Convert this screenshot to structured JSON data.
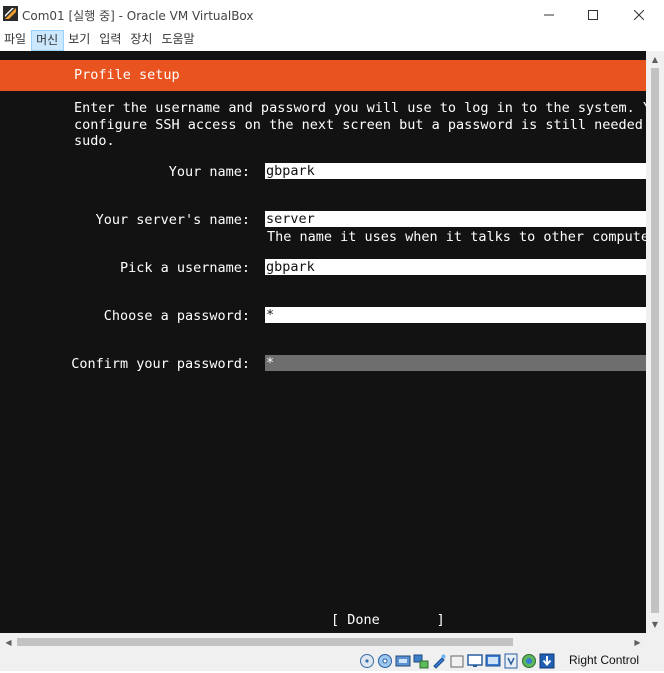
{
  "window": {
    "title": "Com01 [실행 중] - Oracle VM VirtualBox",
    "controls": [
      "minimize",
      "maximize",
      "close"
    ]
  },
  "menu": {
    "items": [
      "파일",
      "머신",
      "보기",
      "입력",
      "장치",
      "도움말"
    ],
    "active": "머신"
  },
  "installer": {
    "header_title": "Profile setup",
    "intro_lines": [
      "Enter the username and password you will use to log in to the system. Yo",
      "configure SSH access on the next screen but a password is still needed f",
      "sudo."
    ],
    "fields": {
      "your_name": {
        "label": "Your name:",
        "value": "gbpark"
      },
      "server_name": {
        "label": "Your server's name:",
        "value": "server",
        "hint": "The name it uses when it talks to other computer"
      },
      "username": {
        "label": "Pick a username:",
        "value": "gbpark"
      },
      "password": {
        "label": "Choose a password:",
        "value": "*"
      },
      "confirm_password": {
        "label": "Confirm your password:",
        "value": "*"
      }
    },
    "done_button": "[ Done       ]"
  },
  "statusbar": {
    "host_key": "Right Control",
    "icons": [
      "hard-disk-icon",
      "optical-drive-icon",
      "audio-icon",
      "network-icon",
      "usb-icon",
      "shared-folders-icon",
      "display-icon",
      "video-capture-icon",
      "virtualization-icon",
      "mouse-integration-icon",
      "host-key-icon"
    ]
  },
  "colors": {
    "accent": "#e9531f",
    "terminal_bg": "#121212",
    "focused_field": "#6e6e6e"
  }
}
